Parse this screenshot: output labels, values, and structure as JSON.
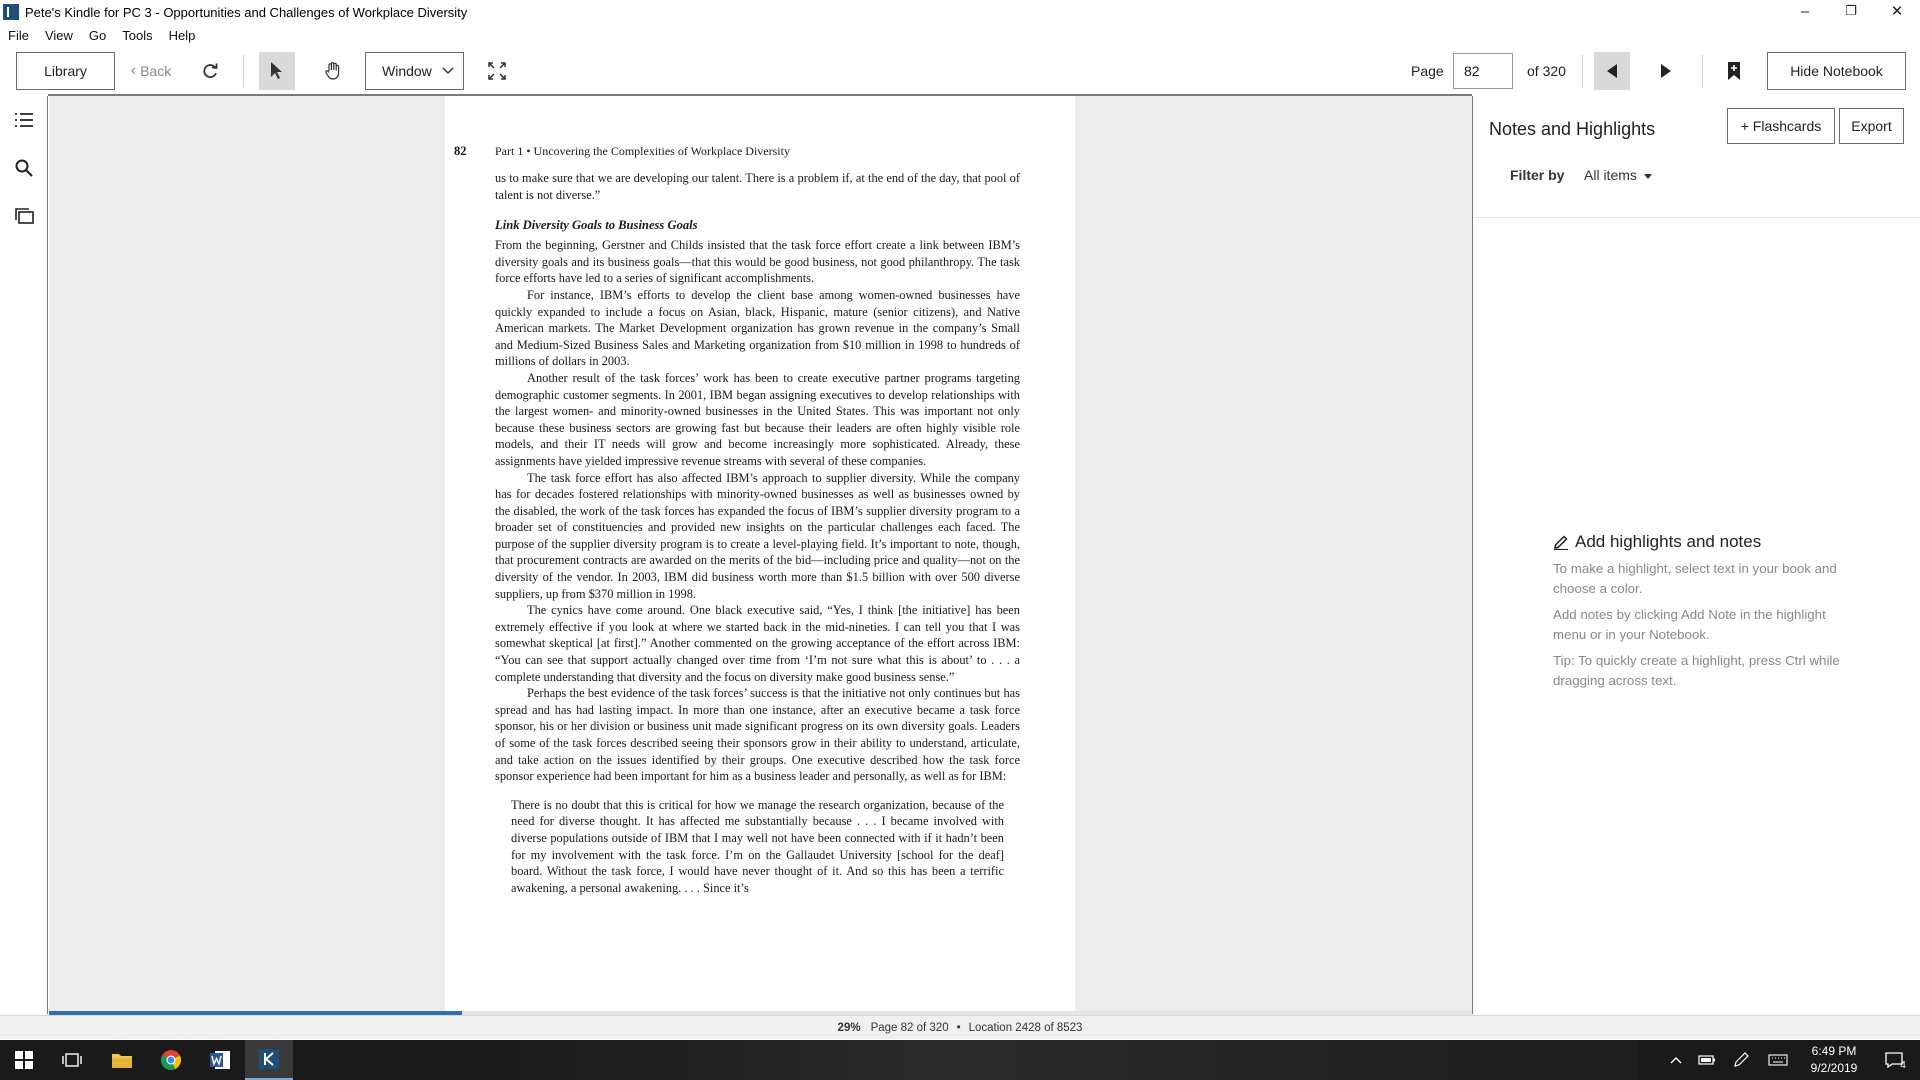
{
  "window": {
    "title": "Pete's Kindle for PC 3 - Opportunities and Challenges of Workplace Diversity",
    "controls": {
      "minimize": "–",
      "restore": "❐",
      "close": "✕"
    }
  },
  "menu": [
    "File",
    "View",
    "Go",
    "Tools",
    "Help"
  ],
  "toolbar": {
    "library_label": "Library",
    "back_label": "Back",
    "view_mode_label": "Window",
    "page_label": "Page",
    "page_value": "82",
    "page_total": "of 320",
    "hide_notebook_label": "Hide Notebook"
  },
  "book_page": {
    "page_number": "82",
    "running_head": "Part 1  •  Uncovering the Complexities of Workplace Diversity",
    "para0": "us to make sure that we are developing our talent. There is a problem if, at the end of the day, that pool of talent is not diverse.”",
    "heading": "Link Diversity Goals to Business Goals",
    "para1": "From the beginning, Gerstner and Childs insisted that the task force effort create a link between IBM’s diversity goals and its business goals—that this would be good business, not good philanthropy. The task force efforts have led to a series of significant accomplishments.",
    "para2": "For instance, IBM’s efforts to develop the client base among women-owned businesses have quickly expanded to include a focus on Asian, black, Hispanic, mature (senior citizens), and Native American markets. The Market Development organization has grown revenue in the company’s Small and Medium-Sized Business Sales and Marketing organization from $10 million in 1998 to hundreds of millions of dollars in 2003.",
    "para3": "Another result of the task forces’ work has been to create executive partner programs targeting demographic customer segments. In 2001, IBM began assigning executives to develop relationships with the largest women- and minority-owned businesses in the United States. This was important not only because these business sectors are growing fast but because their leaders are often highly visible role models, and their IT needs will grow and become increasingly more sophisticated. Already, these assignments have yielded impressive revenue streams with several of these companies.",
    "para4": "The task force effort has also affected IBM’s approach to supplier diversity. While the company has for decades fostered relationships with minority-owned businesses as well as businesses owned by the disabled, the work of the task forces has expanded the focus of IBM’s supplier diversity program to a broader set of constituencies and provided new insights on the particular challenges each faced. The purpose of the supplier diversity program is to create a level-playing field. It’s important to note, though, that procurement contracts are awarded on the merits of the bid—including price and quality—not on the diversity of the vendor. In 2003, IBM did business worth more than $1.5 billion with over 500 diverse suppliers, up from $370 million in 1998.",
    "para5": "The cynics have come around. One black executive said, “Yes, I think [the initiative] has been extremely effective if you look at where we started back in the mid-nineties. I can tell you that I was somewhat skeptical [at first].” Another commented on the growing acceptance of the effort across IBM: “You can see that support actually changed over time from ‘I’m not sure what this is about’ to . . . a complete understanding that diversity and the focus on diversity make good business sense.”",
    "para6": "Perhaps the best evidence of the task forces’ success is that the initiative not only continues but has spread and has had lasting impact. In more than one instance, after an executive became a task force sponsor, his or her division or business unit made significant progress on its own diversity goals. Leaders of some of the task forces described seeing their sponsors grow in their ability to understand, articulate, and take action on the issues identified by their groups. One executive described how the task force sponsor experience had been important for him as a business leader and personally, as well as for IBM:",
    "quote": "There is no doubt that this is critical for how we manage the research organization, because of the need for diverse thought. It has affected me substantially because . . . I became involved with diverse populations outside of IBM that I may well not have been connected with if it hadn’t been for my involvement with the task force. I’m on the Gallaudet University [school for the deaf] board. Without the task force, I would have never thought of it. And so this has been a terrific awakening, a personal awakening. . . . Since it’s"
  },
  "notebook": {
    "title": "Notes and Highlights",
    "flashcards_label": "+ Flashcards",
    "export_label": "Export",
    "filter_label": "Filter by",
    "filter_value": "All items",
    "empty_title": "Add highlights and notes",
    "empty_line1": "To make a highlight, select text in your book and choose a color.",
    "empty_line2": "Add notes by clicking Add Note in the highlight menu or in your Notebook.",
    "empty_line3": "Tip: To quickly create a highlight, press Ctrl while dragging across text."
  },
  "status": {
    "percent": "29%",
    "page": "Page 82 of 320",
    "separator": "•",
    "location": "Location 2428 of 8523",
    "progress": 0.29
  },
  "taskbar": {
    "time": "6:49 PM",
    "date": "9/2/2019",
    "notification_count": "4"
  },
  "colors": {
    "progress": "#2f6fb0",
    "taskbar": "#1a1a1a",
    "reader_background": "#ececec"
  }
}
